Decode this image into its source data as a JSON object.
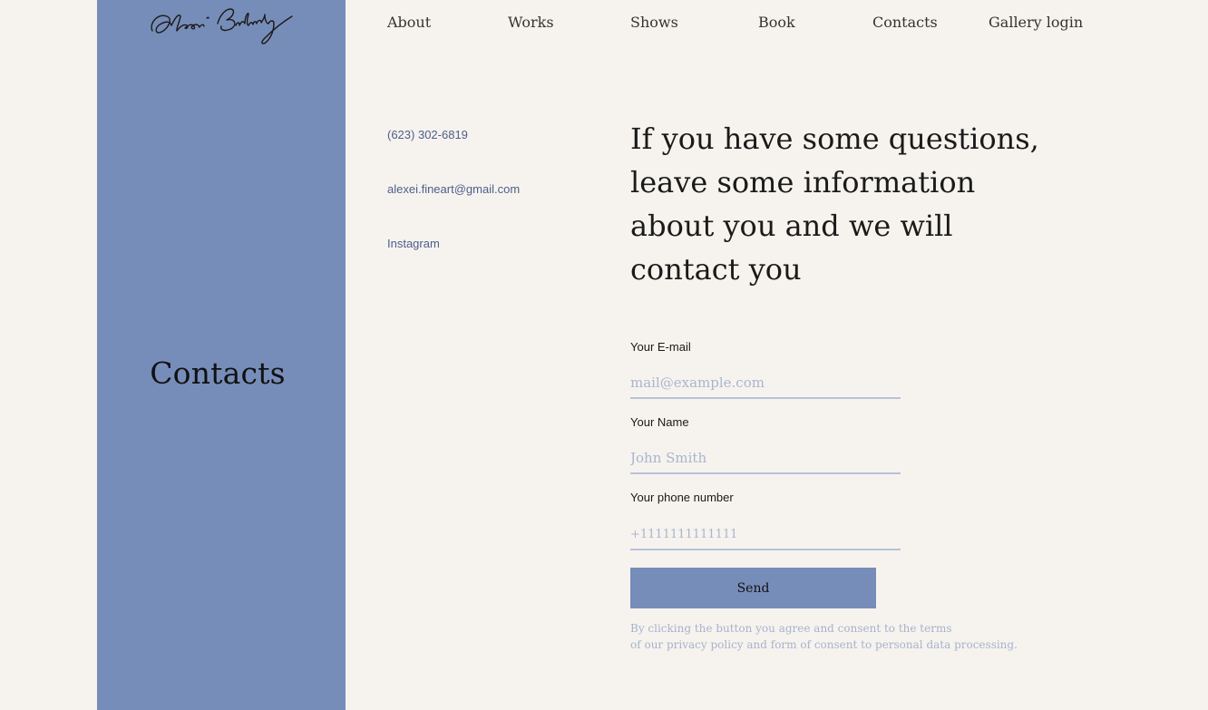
{
  "brand": {
    "signature_icon": "handwritten-signature-logo",
    "sidebar_color": "#778db9",
    "background": "#f6f3ee"
  },
  "sidebar": {
    "title": "Contacts"
  },
  "nav": {
    "items": [
      {
        "label": "About"
      },
      {
        "label": "Works"
      },
      {
        "label": "Shows"
      },
      {
        "label": "Book"
      },
      {
        "label": "Contacts"
      },
      {
        "label": "Gallery login"
      }
    ]
  },
  "contacts": {
    "phone": "(623) 302-6819",
    "email": "alexei.fineart@gmail.com",
    "instagram": "Instagram"
  },
  "form": {
    "heading": "If you have some questions, leave some information about you and we will contact you",
    "email": {
      "label": "Your E-mail",
      "placeholder": "mail@example.com",
      "value": ""
    },
    "name": {
      "label": "Your Name",
      "placeholder": "John Smith",
      "value": ""
    },
    "phone": {
      "label": "Your phone number",
      "placeholder": "+1111111111111",
      "value": ""
    },
    "send_label": "Send",
    "consent_line1": "By clicking the button you agree and consent to the terms",
    "consent_line2": "of our privacy policy and form of consent to personal data processing."
  }
}
